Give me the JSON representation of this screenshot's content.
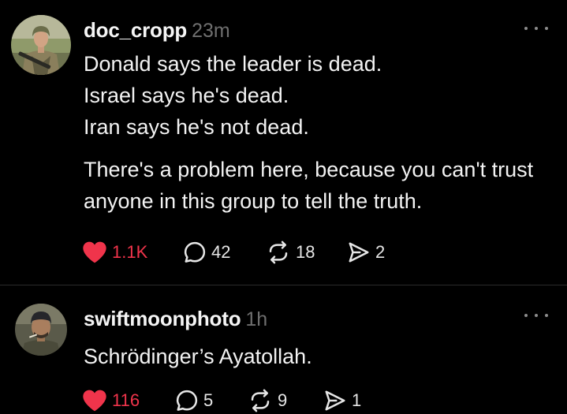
{
  "posts": [
    {
      "username": "doc_cropp",
      "time": "23m",
      "avatar": "avatar-soldier-icon",
      "paragraphs": [
        [
          "Donald says the leader is dead.",
          "Israel says he's dead.",
          "Iran says he's not dead."
        ],
        [
          "There's a problem here, because you can't trust",
          "anyone in this group to tell the truth."
        ]
      ],
      "likes": "1.1K",
      "comments": "42",
      "reposts": "18",
      "shares": "2",
      "liked": true
    },
    {
      "username": "swiftmoonphoto",
      "time": "1h",
      "avatar": "avatar-man-beanie-icon",
      "paragraphs": [
        [
          "Schrödinger’s Ayatollah."
        ]
      ],
      "likes": "116",
      "comments": "5",
      "reposts": "9",
      "shares": "1",
      "liked": true
    }
  ],
  "colors": {
    "background": "#000000",
    "text": "#f3f3f3",
    "muted": "#6f6f6f",
    "like": "#f0344b",
    "divider": "#2a2a2a"
  }
}
